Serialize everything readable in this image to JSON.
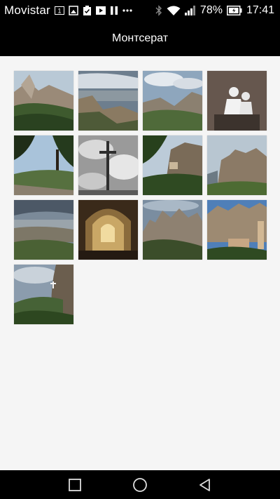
{
  "status_bar": {
    "carrier": "Movistar",
    "battery": "78%",
    "time": "17:41",
    "icons": [
      "sim-1-icon",
      "gallery-notification-icon",
      "clipboard-icon",
      "media-icon",
      "pause-icon",
      "more-icon",
      "bluetooth-icon",
      "wifi-icon",
      "signal-icon",
      "battery-icon"
    ]
  },
  "header": {
    "title": "Монтсерат"
  },
  "gallery": {
    "photos": [
      {
        "id": "photo-1",
        "subject": "mountain-valley-view"
      },
      {
        "id": "photo-2",
        "subject": "cliffs-and-plain"
      },
      {
        "id": "photo-3",
        "subject": "mountain-ridge-clouds"
      },
      {
        "id": "photo-4",
        "subject": "white-sculpture"
      },
      {
        "id": "photo-5",
        "subject": "trees-and-path"
      },
      {
        "id": "photo-6",
        "subject": "cross-monochrome-sky"
      },
      {
        "id": "photo-7",
        "subject": "green-cliffs-building"
      },
      {
        "id": "photo-8",
        "subject": "rock-formations"
      },
      {
        "id": "photo-9",
        "subject": "valley-panorama"
      },
      {
        "id": "photo-10",
        "subject": "basilica-interior"
      },
      {
        "id": "photo-11",
        "subject": "rocky-peaks"
      },
      {
        "id": "photo-12",
        "subject": "monastery-under-cliffs"
      },
      {
        "id": "photo-13",
        "subject": "cliff-with-cross"
      }
    ]
  },
  "nav_bar": {
    "buttons": [
      "recent-apps-icon",
      "home-icon",
      "back-icon"
    ]
  }
}
